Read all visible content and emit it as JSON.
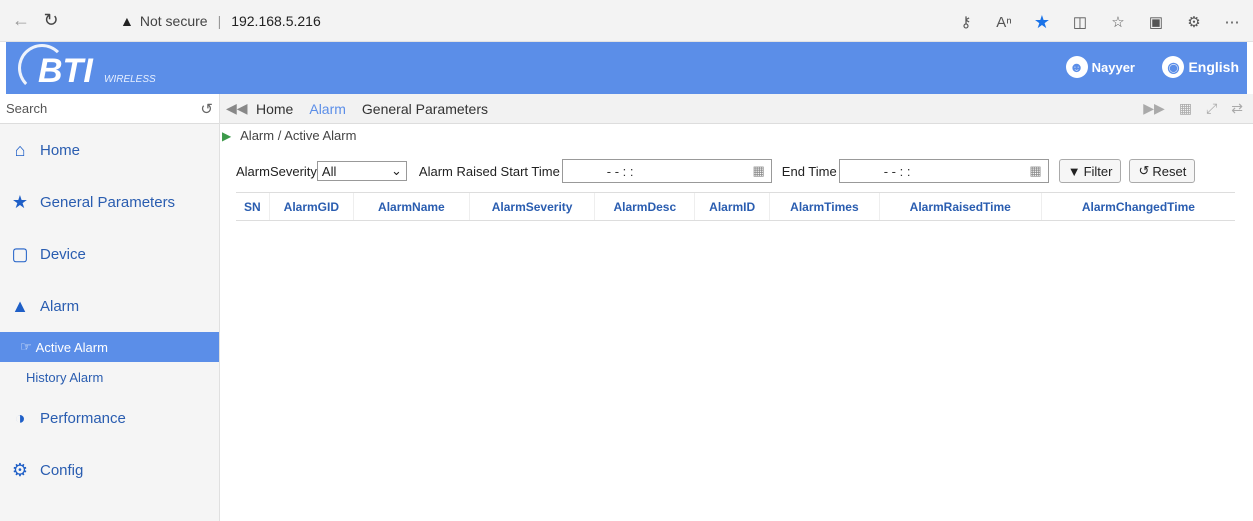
{
  "browser": {
    "not_secure": "Not secure",
    "separator": "|",
    "url": "192.168.5.216"
  },
  "header": {
    "logo_text": "BTI",
    "logo_sub": "WIRELESS",
    "user": "Nayyer",
    "language": "English",
    "brand_color": "#5b8ee8"
  },
  "sidebar": {
    "search_placeholder": "Search",
    "items": [
      {
        "label": "Home",
        "icon": "home-icon"
      },
      {
        "label": "General Parameters",
        "icon": "star-icon"
      },
      {
        "label": "Device",
        "icon": "device-icon"
      },
      {
        "label": "Alarm",
        "icon": "bell-icon"
      }
    ],
    "sub_items": [
      {
        "label": "Active Alarm",
        "active": true
      },
      {
        "label": "History Alarm",
        "active": false
      }
    ],
    "items_after": [
      {
        "label": "Performance",
        "icon": "performance-icon"
      },
      {
        "label": "Config",
        "icon": "gear-icon"
      }
    ]
  },
  "tabs": [
    "Home",
    "Alarm",
    "General Parameters"
  ],
  "path": "Alarm / Active Alarm",
  "filters": {
    "severity_label": "AlarmSeverity",
    "severity_value": "All",
    "start_label": "Alarm Raised Start Time",
    "date_placeholder": "-  -       :  :",
    "end_label": "End Time",
    "filter_btn": "Filter",
    "reset_btn": "Reset"
  },
  "table": {
    "columns": [
      "SN",
      "AlarmGID",
      "AlarmName",
      "AlarmSeverity",
      "AlarmDesc",
      "AlarmID",
      "AlarmTimes",
      "AlarmRaisedTime",
      "AlarmChangedTime"
    ]
  }
}
